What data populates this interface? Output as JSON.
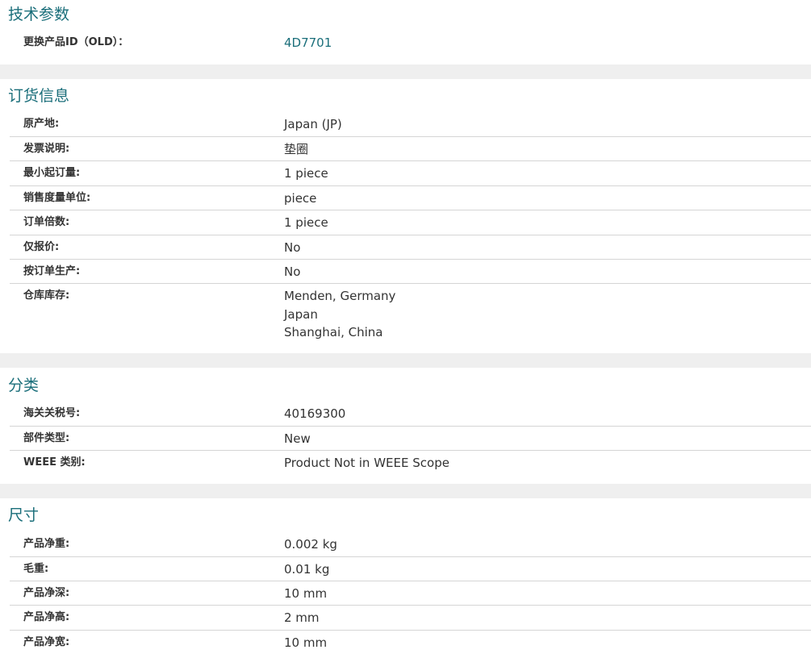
{
  "sections": {
    "tech": {
      "title": "技术参数",
      "rows": [
        {
          "label": "更换产品ID（OLD）：",
          "value": "4D7701"
        }
      ]
    },
    "order": {
      "title": "订货信息",
      "rows": [
        {
          "label": "原产地:",
          "value": "Japan (JP)"
        },
        {
          "label": "发票说明:",
          "value": "垫圈"
        },
        {
          "label": "最小起订量:",
          "value": "1 piece"
        },
        {
          "label": "销售度量单位:",
          "value": "piece"
        },
        {
          "label": "订单倍数:",
          "value": "1 piece"
        },
        {
          "label": "仅报价:",
          "value": "No"
        },
        {
          "label": "按订单生产:",
          "value": "No"
        },
        {
          "label": "仓库库存:",
          "values": [
            "Menden, Germany",
            "Japan",
            "Shanghai, China"
          ]
        }
      ]
    },
    "category": {
      "title": "分类",
      "rows": [
        {
          "label": "海关关税号:",
          "value": "40169300"
        },
        {
          "label": "部件类型:",
          "value": "New"
        },
        {
          "label": "WEEE 类别:",
          "value": "Product Not in WEEE Scope"
        }
      ]
    },
    "dimensions": {
      "title": "尺寸",
      "rows": [
        {
          "label": "产品净重:",
          "value": "0.002 kg"
        },
        {
          "label": "毛重:",
          "value": "0.01 kg"
        },
        {
          "label": "产品净深:",
          "value": "10 mm"
        },
        {
          "label": "产品净高:",
          "value": "2 mm"
        },
        {
          "label": "产品净宽:",
          "value": "10 mm"
        }
      ]
    }
  },
  "colors": {
    "heading": "#1a6e7a",
    "link": "#1a6e7a",
    "band": "#efefef",
    "divider": "#d5d5d5"
  }
}
